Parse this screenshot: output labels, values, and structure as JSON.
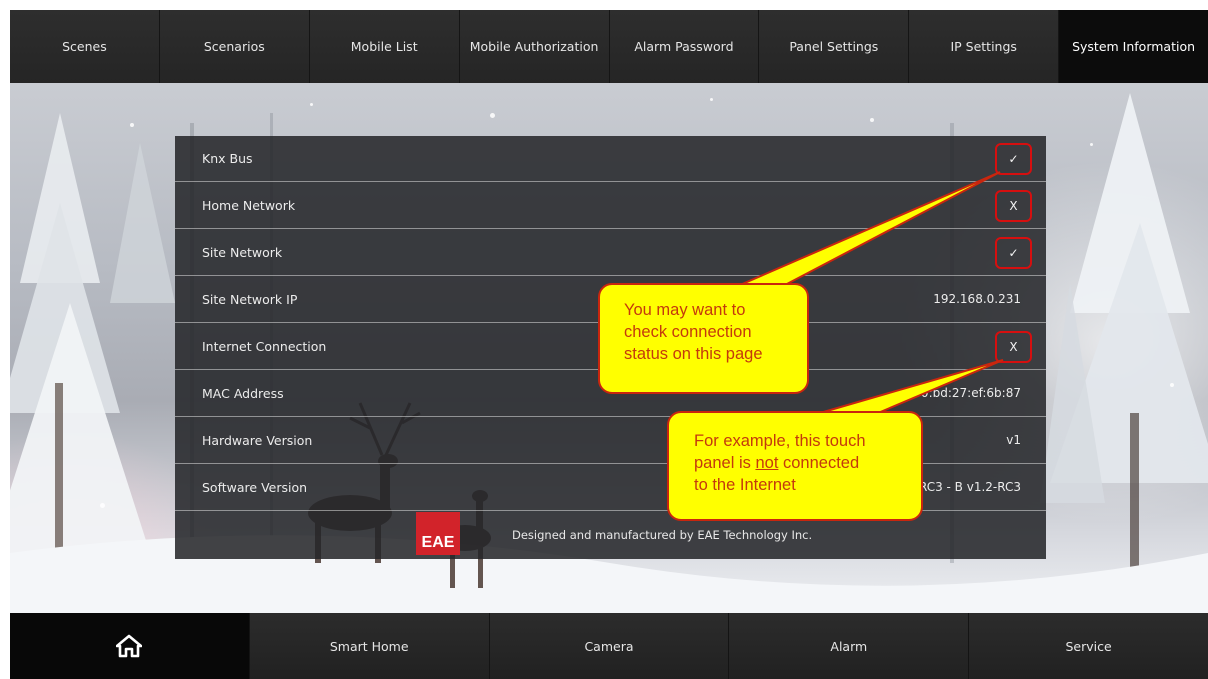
{
  "top_tabs": [
    {
      "label": "Scenes"
    },
    {
      "label": "Scenarios"
    },
    {
      "label": "Mobile List"
    },
    {
      "label": "Mobile Authorization"
    },
    {
      "label": "Alarm Password"
    },
    {
      "label": "Panel Settings"
    },
    {
      "label": "IP Settings"
    },
    {
      "label": "System Information"
    }
  ],
  "active_tab": "System Information",
  "info_rows": [
    {
      "label": "Knx Bus",
      "status": "✓"
    },
    {
      "label": "Home Network",
      "status": "X"
    },
    {
      "label": "Site Network",
      "status": "✓"
    },
    {
      "label": "Site Network IP",
      "value": "192.168.0.231"
    },
    {
      "label": "Internet Connection",
      "status": "X"
    },
    {
      "label": "MAC Address",
      "value": "00:bd:27:ef:6b:87"
    },
    {
      "label": "Hardware Version",
      "value": "v1"
    },
    {
      "label": "Software Version",
      "value": "RC3 - B v1.2-RC3"
    }
  ],
  "footer": {
    "logo_text": "EAE",
    "credit": "Designed and manufactured by EAE Technology Inc."
  },
  "callouts": {
    "first": {
      "lines": [
        "You may want to",
        "check connection",
        "status on this page"
      ]
    },
    "second": {
      "line1": "For example, this touch",
      "line2_pre": "panel is ",
      "line2_underlined": "not",
      "line2_post": " connected",
      "line3": "to the Internet"
    }
  },
  "bottom_tabs": [
    {
      "label": "Smart Home"
    },
    {
      "label": "Camera"
    },
    {
      "label": "Alarm"
    },
    {
      "label": "Service"
    }
  ],
  "icons": {
    "home": "home-icon"
  },
  "colors": {
    "highlight_border": "#d60f0f",
    "callout_fill": "#ffff00",
    "callout_text": "#c43a0c"
  }
}
